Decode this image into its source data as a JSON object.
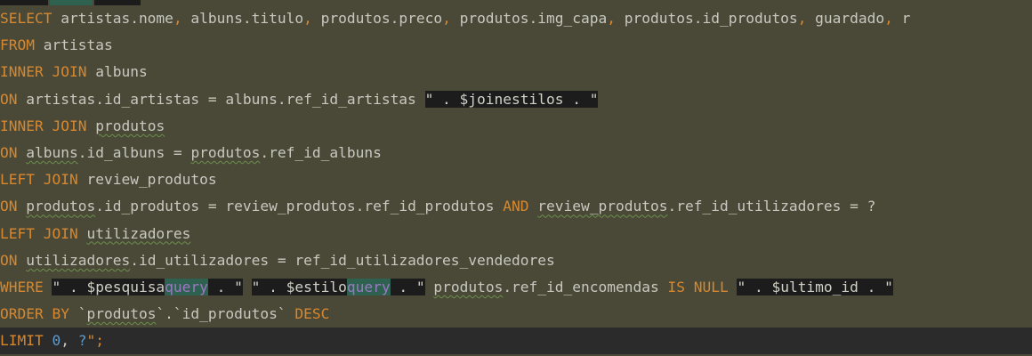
{
  "editor": {
    "lines": [
      {
        "tokens": [
          {
            "t": "SELECT",
            "c": "kw"
          },
          {
            "t": " artistas.nome"
          },
          {
            "t": ",",
            "c": "kw"
          },
          {
            "t": " albuns.titulo"
          },
          {
            "t": ",",
            "c": "kw"
          },
          {
            "t": " produtos.preco"
          },
          {
            "t": ",",
            "c": "kw"
          },
          {
            "t": " produtos.img_capa"
          },
          {
            "t": ",",
            "c": "kw"
          },
          {
            "t": " produtos.id_produtos"
          },
          {
            "t": ",",
            "c": "kw"
          },
          {
            "t": " guardado"
          },
          {
            "t": ",",
            "c": "kw"
          },
          {
            "t": " r"
          }
        ]
      },
      {
        "tokens": [
          {
            "t": "FROM",
            "c": "kw"
          },
          {
            "t": " artistas"
          }
        ]
      },
      {
        "tokens": [
          {
            "t": "INNER JOIN",
            "c": "kw"
          },
          {
            "t": " albuns"
          }
        ]
      },
      {
        "tokens": [
          {
            "t": "ON",
            "c": "kw"
          },
          {
            "t": " artistas.id_artistas = albuns.ref_id_artistas "
          },
          {
            "t": "\" . ",
            "c": "str"
          },
          {
            "t": "$joinestilos",
            "c": "var str"
          },
          {
            "t": " . \"",
            "c": "str"
          }
        ]
      },
      {
        "tokens": [
          {
            "t": "INNER JOIN",
            "c": "kw"
          },
          {
            "t": " "
          },
          {
            "t": "produtos",
            "c": "squiggle"
          }
        ]
      },
      {
        "tokens": [
          {
            "t": "ON",
            "c": "kw"
          },
          {
            "t": " "
          },
          {
            "t": "albuns",
            "c": "squiggle"
          },
          {
            "t": ".id_albuns = "
          },
          {
            "t": "produtos",
            "c": "squiggle"
          },
          {
            "t": ".ref_id_albuns"
          }
        ]
      },
      {
        "tokens": [
          {
            "t": "LEFT JOIN",
            "c": "kw"
          },
          {
            "t": " review_produtos"
          }
        ]
      },
      {
        "tokens": [
          {
            "t": "ON",
            "c": "kw"
          },
          {
            "t": " "
          },
          {
            "t": "produtos",
            "c": "squiggle"
          },
          {
            "t": ".id_produtos = review_produtos.ref_id_produtos "
          },
          {
            "t": "AND",
            "c": "kw"
          },
          {
            "t": " "
          },
          {
            "t": "review_produtos",
            "c": "squiggle"
          },
          {
            "t": ".ref_id_utilizadores = ?"
          }
        ]
      },
      {
        "tokens": [
          {
            "t": "LEFT JOIN",
            "c": "kw"
          },
          {
            "t": " "
          },
          {
            "t": "utilizadores",
            "c": "squiggle"
          }
        ]
      },
      {
        "tokens": [
          {
            "t": "ON",
            "c": "kw"
          },
          {
            "t": " "
          },
          {
            "t": "utilizadores",
            "c": "squiggle"
          },
          {
            "t": ".id_utilizadores = ref_id_utilizadores_vendedores"
          }
        ]
      },
      {
        "tokens": [
          {
            "t": "WHERE",
            "c": "kw"
          },
          {
            "t": " "
          },
          {
            "t": "\" . ",
            "c": "str"
          },
          {
            "t": "$pesquisa",
            "c": "var str"
          },
          {
            "t": "query",
            "c": "hl"
          },
          {
            "t": " . \"",
            "c": "str"
          },
          {
            "t": " "
          },
          {
            "t": "\" . ",
            "c": "str"
          },
          {
            "t": "$estilo",
            "c": "var str"
          },
          {
            "t": "query",
            "c": "hl"
          },
          {
            "t": " . \"",
            "c": "str"
          },
          {
            "t": " "
          },
          {
            "t": "produtos",
            "c": "squiggle"
          },
          {
            "t": ".ref_id_encomendas "
          },
          {
            "t": "IS NULL",
            "c": "kw"
          },
          {
            "t": " "
          },
          {
            "t": "\" . ",
            "c": "str"
          },
          {
            "t": "$ultimo_id",
            "c": "var str"
          },
          {
            "t": " . \"",
            "c": "str"
          }
        ]
      },
      {
        "tokens": [
          {
            "t": "ORDER BY",
            "c": "kw"
          },
          {
            "t": " `"
          },
          {
            "t": "produtos",
            "c": "squiggle"
          },
          {
            "t": "`.`id_produtos` "
          },
          {
            "t": "DESC",
            "c": "kw"
          }
        ]
      },
      {
        "tokens": [
          {
            "t": "LIMIT",
            "c": "kw"
          },
          {
            "t": " "
          },
          {
            "t": "0",
            "c": "num"
          },
          {
            "t": ", "
          },
          {
            "t": "?",
            "c": "num"
          },
          {
            "t": "\";",
            "c": "kw"
          }
        ],
        "current": true
      }
    ]
  }
}
